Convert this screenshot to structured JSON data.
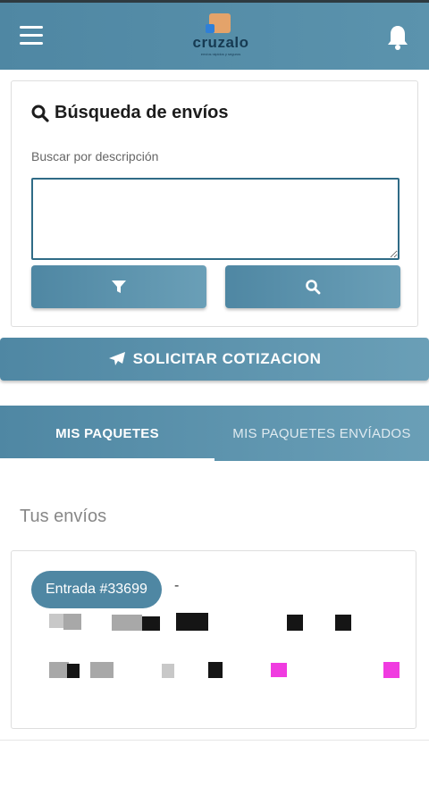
{
  "header": {
    "logo_text": "cruzalo",
    "logo_tagline": "envíos rápidos y seguros",
    "icons": [
      "hamburger-menu-icon",
      "bell-icon"
    ],
    "color": "#5b93ad"
  },
  "search": {
    "title": "Búsqueda de envíos",
    "label": "Buscar por descripción",
    "value": "",
    "placeholder": ""
  },
  "actions": {
    "quote_label": "SOLICITAR COTIZACION"
  },
  "tabs": [
    {
      "label": "MIS PAQUETES",
      "active": true
    },
    {
      "label": "MIS PAQUETES ENVÍADOS",
      "active": false
    }
  ],
  "shipments": {
    "section_title": "Tus envíos",
    "items": [
      {
        "entry_label": "Entrada #33699",
        "separator": "-"
      }
    ]
  },
  "colors": {
    "primary": "#4f87a3",
    "input_border": "#2f6b86"
  }
}
